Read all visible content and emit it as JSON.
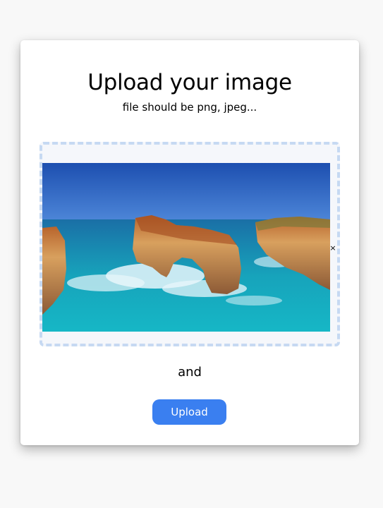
{
  "upload": {
    "title": "Upload your image",
    "subtitle": "file should be png, jpeg...",
    "remove_icon": "×",
    "and_text": "and",
    "button_label": "Upload"
  },
  "icons": {
    "remove": "close-icon"
  },
  "colors": {
    "background": "#f8f8f8",
    "card": "#ffffff",
    "drop_zone_border": "#c6d9f2",
    "drop_zone_fill": "#f5f7fb",
    "button": "#3a7ff0",
    "button_text": "#ffffff"
  }
}
